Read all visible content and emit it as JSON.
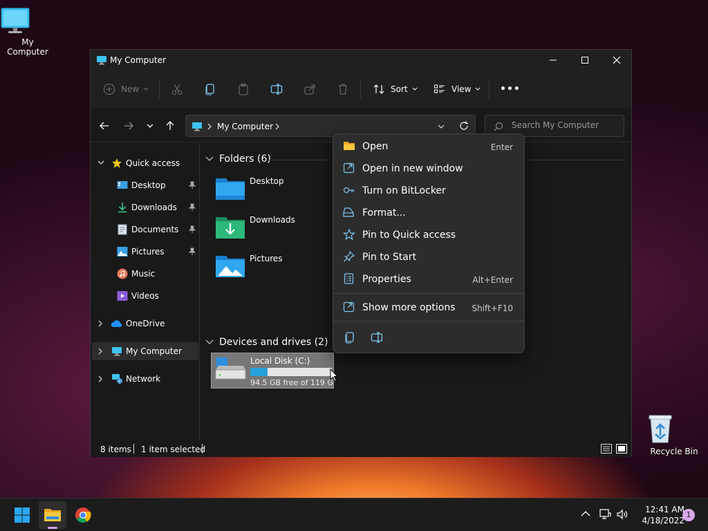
{
  "desktop": {
    "icons": [
      {
        "label": "My Computer"
      },
      {
        "label": "Recycle Bin"
      }
    ]
  },
  "window": {
    "title": "My Computer",
    "toolbar": {
      "new_label": "New",
      "sort_label": "Sort",
      "view_label": "View",
      "more_label": "•••"
    },
    "address": {
      "path": "My Computer"
    },
    "search": {
      "placeholder": "Search My Computer"
    },
    "sidebar": {
      "quick_access": "Quick access",
      "items": [
        {
          "label": "Desktop"
        },
        {
          "label": "Downloads"
        },
        {
          "label": "Documents"
        },
        {
          "label": "Pictures"
        },
        {
          "label": "Music"
        },
        {
          "label": "Videos"
        }
      ],
      "onedrive": "OneDrive",
      "my_computer": "My Computer",
      "network": "Network"
    },
    "content": {
      "folders_header": "Folders (6)",
      "folders": [
        {
          "label": "Desktop"
        },
        {
          "label": "Downloads"
        },
        {
          "label": "Pictures"
        }
      ],
      "devices_header": "Devices and drives (2)",
      "drive": {
        "name": "Local Disk (C:)",
        "free_text": "94.5 GB free of 119 GB",
        "used_fraction": 0.21
      }
    },
    "status": {
      "items": "8 items",
      "selected": "1 item selected"
    }
  },
  "context_menu": {
    "items": [
      {
        "label": "Open",
        "shortcut": "Enter"
      },
      {
        "label": "Open in new window",
        "shortcut": ""
      },
      {
        "label": "Turn on BitLocker",
        "shortcut": ""
      },
      {
        "label": "Format...",
        "shortcut": ""
      },
      {
        "label": "Pin to Quick access",
        "shortcut": ""
      },
      {
        "label": "Pin to Start",
        "shortcut": ""
      },
      {
        "label": "Properties",
        "shortcut": "Alt+Enter"
      },
      {
        "label": "Show more options",
        "shortcut": "Shift+F10"
      }
    ]
  },
  "taskbar": {
    "time": "12:41 AM",
    "date": "4/18/2022",
    "notification_count": "1"
  },
  "colors": {
    "accent": "#26a0da",
    "folder_blue": "#1f8fd8",
    "folder_green": "#22a06b"
  }
}
